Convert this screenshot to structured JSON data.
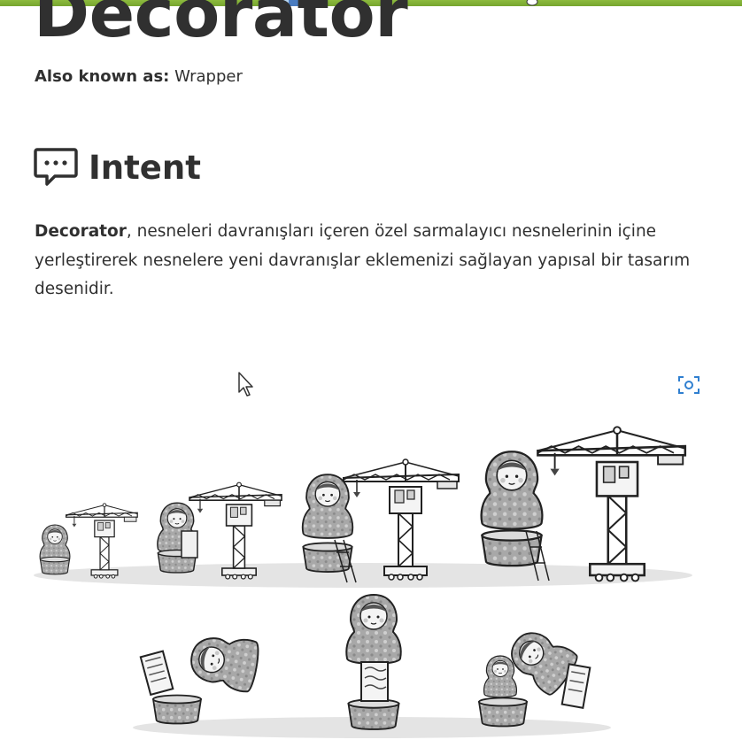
{
  "page": {
    "title": "Decorator",
    "aka_label": "Also known as:",
    "aka_value": " Wrapper"
  },
  "intent": {
    "heading": "Intent",
    "lead": "Decorator",
    "body": ", nesneleri davranışları içeren özel sarmalayıcı nesnelerinin içine yerleştirerek nesnelere yeni davranışlar eklemenizi sağlayan yapısal bir tasarım desenidir."
  },
  "icons": {
    "intent": "speech-bubble-icon",
    "screenshot": "camera-capture-icon",
    "cursor": "mouse-pointer-icon"
  },
  "colors": {
    "topbar": "#7fae35",
    "text": "#303030",
    "capture_icon": "#2f7fd0"
  }
}
